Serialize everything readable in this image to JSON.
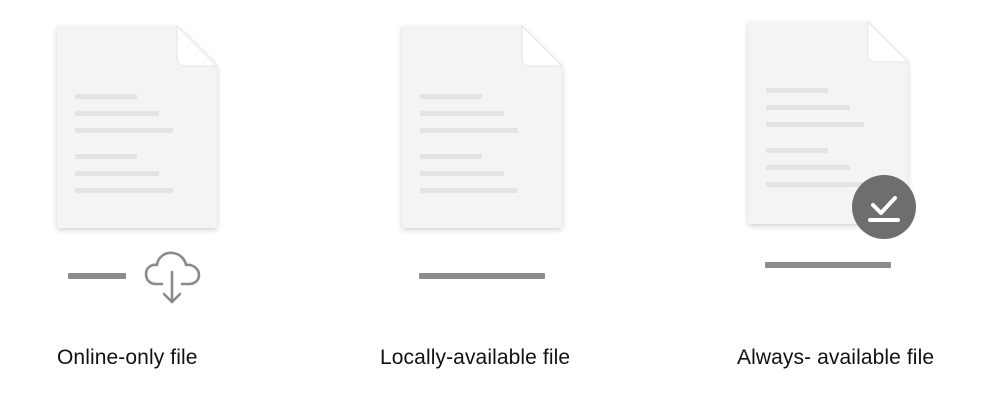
{
  "colors": {
    "page_bg": "#ffffff",
    "doc_fill": "#f4f4f4",
    "doc_lines": "#e3e3e3",
    "placeholder_bar": "#8c8c8c",
    "cloud_stroke": "#8a8a8a",
    "check_badge": "#6e6e6e",
    "caption_text": "#111111"
  },
  "files": [
    {
      "status": "online-only",
      "caption": "Online-only file",
      "status_icon": "cloud-download-icon"
    },
    {
      "status": "locally-available",
      "caption": "Locally-available file",
      "status_icon": ""
    },
    {
      "status": "always-available",
      "caption": "Always- available file",
      "status_icon": "checkmark-badge-icon"
    }
  ]
}
